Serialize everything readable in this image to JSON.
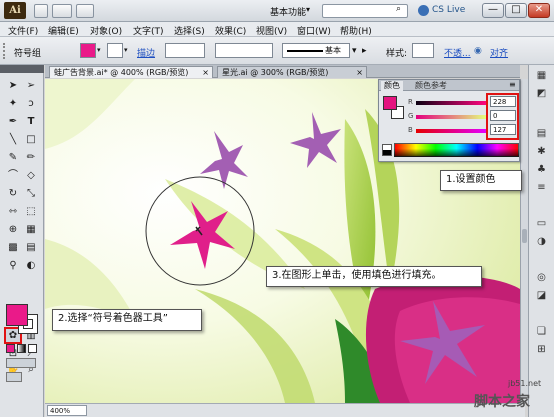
{
  "app": {
    "logo": "Ai",
    "workspace": "基本功能",
    "search_placeholder": "",
    "cs_live": "CS Live",
    "win_min": "—",
    "win_max": "□",
    "win_close": "✕",
    "workspace_arrow": "▾"
  },
  "menu": [
    "文件(F)",
    "编辑(E)",
    "对象(O)",
    "文字(T)",
    "选择(S)",
    "效果(C)",
    "视图(V)",
    "窗口(W)",
    "帮助(H)"
  ],
  "control_bar": {
    "object_label": "符号组",
    "fill_color": "#ea1a89",
    "stroke_label": "描边",
    "brush_label": "基本",
    "style_label": "样式:",
    "opacity_link": "不透...",
    "align_link": "对齐"
  },
  "tabs": [
    {
      "label": "蛙广告背景.ai* @ 400% (RGB/预览)",
      "close": "×"
    },
    {
      "label": "星光.ai @ 300% (RGB/预览)",
      "close": "×"
    }
  ],
  "color_panel": {
    "tab_color": "颜色",
    "tab_guide": "颜色参考",
    "channels": [
      {
        "label": "R",
        "value": "228",
        "gradient": "linear-gradient(90deg,#0b0012,#ff067f)"
      },
      {
        "label": "G",
        "value": "0",
        "gradient": "linear-gradient(90deg,#e4007f,#e4ff7f)"
      },
      {
        "label": "B",
        "value": "127",
        "gradient": "linear-gradient(90deg,#e40000,#e400ff)"
      }
    ],
    "fill_color": "#e4147f"
  },
  "callouts": {
    "step1": "1.设置颜色",
    "step2": "2.选择“符号着色器工具”",
    "step3": "3.在图形上单击，使用填色进行填充。"
  },
  "status": {
    "zoom": "400%"
  },
  "tools_fill_color": "#ea1a89",
  "watermark": {
    "url": "jb51.net",
    "text": "脚本之家"
  }
}
